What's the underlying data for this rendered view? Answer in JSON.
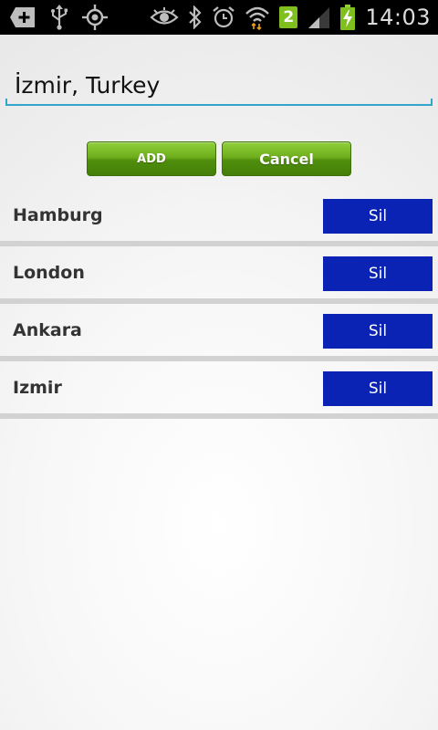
{
  "status_bar": {
    "time": "14:03",
    "notification_count": "2",
    "icons_left": [
      "add-box-icon",
      "usb-icon",
      "gps-icon"
    ],
    "icons_right": [
      "eye-icon",
      "bluetooth-icon",
      "alarm-icon",
      "wifi-icon",
      "signal-icon",
      "battery-charging-icon"
    ]
  },
  "search": {
    "value": "İzmir, Turkey",
    "accent_color": "#33a5cc"
  },
  "buttons": {
    "add_label": "ADD",
    "cancel_label": "Cancel"
  },
  "cities": [
    {
      "name": "Hamburg",
      "action": "Sil"
    },
    {
      "name": "London",
      "action": "Sil"
    },
    {
      "name": "Ankara",
      "action": "Sil"
    },
    {
      "name": "Izmir",
      "action": "Sil"
    }
  ],
  "colors": {
    "delete_button": "#0b23b5",
    "row_divider": "#d2d2d2",
    "add_button_green": "#6fae1e"
  }
}
